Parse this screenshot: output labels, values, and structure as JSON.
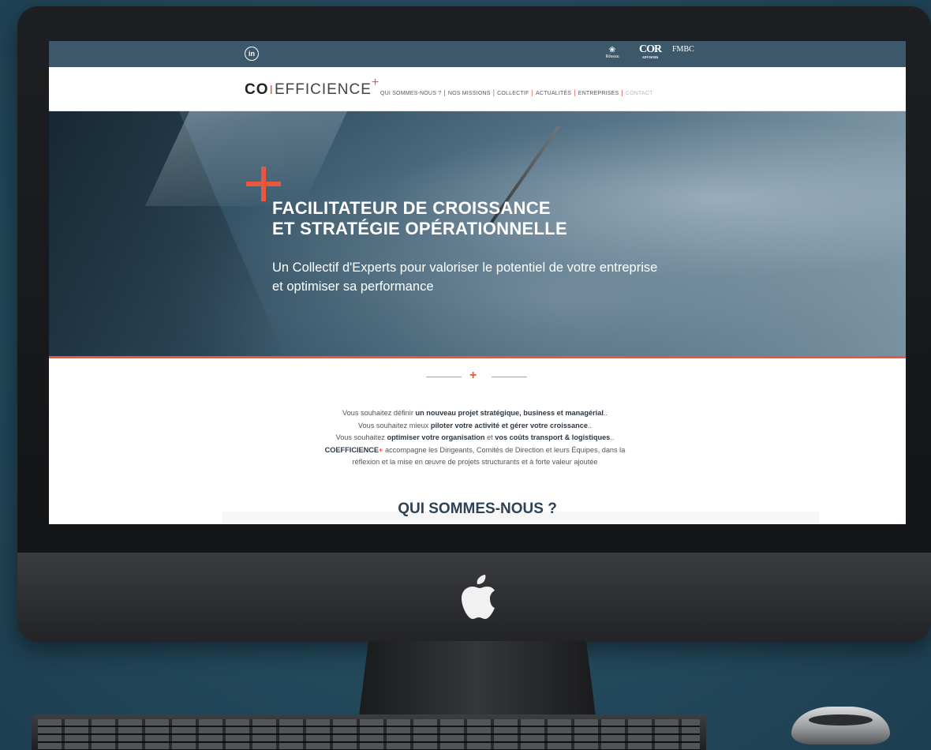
{
  "topbar": {
    "social_icon": "linkedin-icon",
    "social_label": "in",
    "partners": [
      {
        "name": "Réseau",
        "mark": "❀"
      },
      {
        "name": "COR",
        "sub": "ADVISORS"
      },
      {
        "name": "FMBC"
      }
    ]
  },
  "brand": {
    "co": "CO",
    "bar": "I",
    "rest": "EFFICIENCE",
    "plus": "+"
  },
  "nav": {
    "items": [
      "QUI SOMMES-NOUS ?",
      "NOS MISSIONS",
      "COLLECTIF",
      "ACTUALITÉS",
      "ENTREPRISES",
      "CONTACT"
    ]
  },
  "hero": {
    "title_line1": "FACILITATEUR DE CROISSANCE",
    "title_line2": "ET STRATÉGIE OPÉRATIONNELLE",
    "subtitle_line1": "Un Collectif d'Experts pour valoriser le potentiel de votre entreprise",
    "subtitle_line2": "et optimiser sa performance"
  },
  "intro": {
    "l1_a": "Vous souhaitez définir ",
    "l1_b": "un nouveau projet stratégique, business et managérial",
    "l1_c": "..",
    "l2_a": "Vous souhaitez mieux ",
    "l2_b": "piloter votre activité et gérer votre croissance",
    "l2_c": "..",
    "l3_a": "Vous souhaitez ",
    "l3_b": "optimiser votre organisation",
    "l3_c": " et ",
    "l3_d": "vos coûts transport & logistiques",
    "l3_e": "..",
    "l4_brand": "COEFFICIENCE",
    "l4_plus": "+",
    "l4_rest": " accompagne les Dirigeants, Comités de Direction et leurs Équipes, dans la",
    "l5": "réflexion et la mise en œuvre de projets structurants et à forte valeur ajoutée"
  },
  "section": {
    "title": "QUI SOMMES-NOUS ?"
  },
  "colors": {
    "accent": "#e8583c",
    "topbar": "#3d586b",
    "background": "#244a5d"
  }
}
